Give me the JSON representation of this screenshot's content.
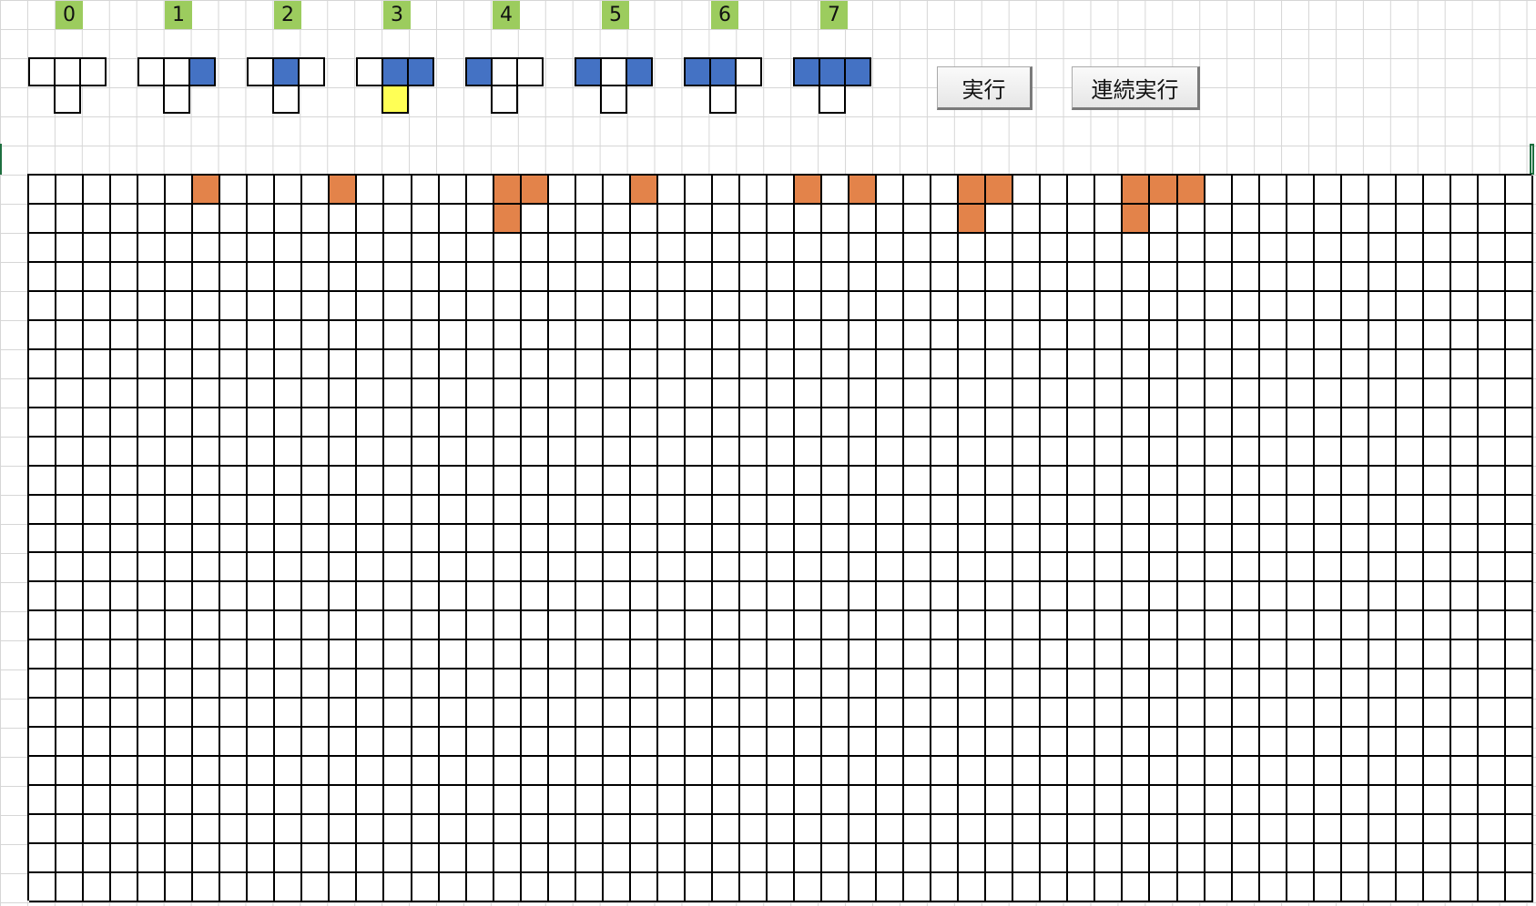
{
  "colors": {
    "label_bg": "#9ccc5e",
    "rule_on": "#4472c4",
    "rule_highlight": "#ffff55",
    "cell_on": "#e3834a",
    "cell_off": "#ffffff"
  },
  "rules": [
    {
      "label": "0",
      "top": [
        0,
        0,
        0
      ],
      "bottom": "white"
    },
    {
      "label": "1",
      "top": [
        0,
        0,
        1
      ],
      "bottom": "white"
    },
    {
      "label": "2",
      "top": [
        0,
        1,
        0
      ],
      "bottom": "white"
    },
    {
      "label": "3",
      "top": [
        0,
        1,
        1
      ],
      "bottom": "yellow"
    },
    {
      "label": "4",
      "top": [
        1,
        0,
        0
      ],
      "bottom": "white"
    },
    {
      "label": "5",
      "top": [
        1,
        0,
        1
      ],
      "bottom": "white"
    },
    {
      "label": "6",
      "top": [
        1,
        1,
        0
      ],
      "bottom": "white"
    },
    {
      "label": "7",
      "top": [
        1,
        1,
        1
      ],
      "bottom": "white"
    }
  ],
  "buttons": {
    "run": "実行",
    "run_continuous": "連続実行"
  },
  "grid": {
    "columns": 55,
    "rows": 25,
    "filled": [
      [
        0,
        6
      ],
      [
        0,
        11
      ],
      [
        0,
        17
      ],
      [
        0,
        18
      ],
      [
        0,
        22
      ],
      [
        0,
        28
      ],
      [
        0,
        30
      ],
      [
        0,
        34
      ],
      [
        0,
        35
      ],
      [
        0,
        40
      ],
      [
        0,
        41
      ],
      [
        0,
        42
      ],
      [
        1,
        17
      ],
      [
        1,
        34
      ],
      [
        1,
        40
      ]
    ]
  }
}
